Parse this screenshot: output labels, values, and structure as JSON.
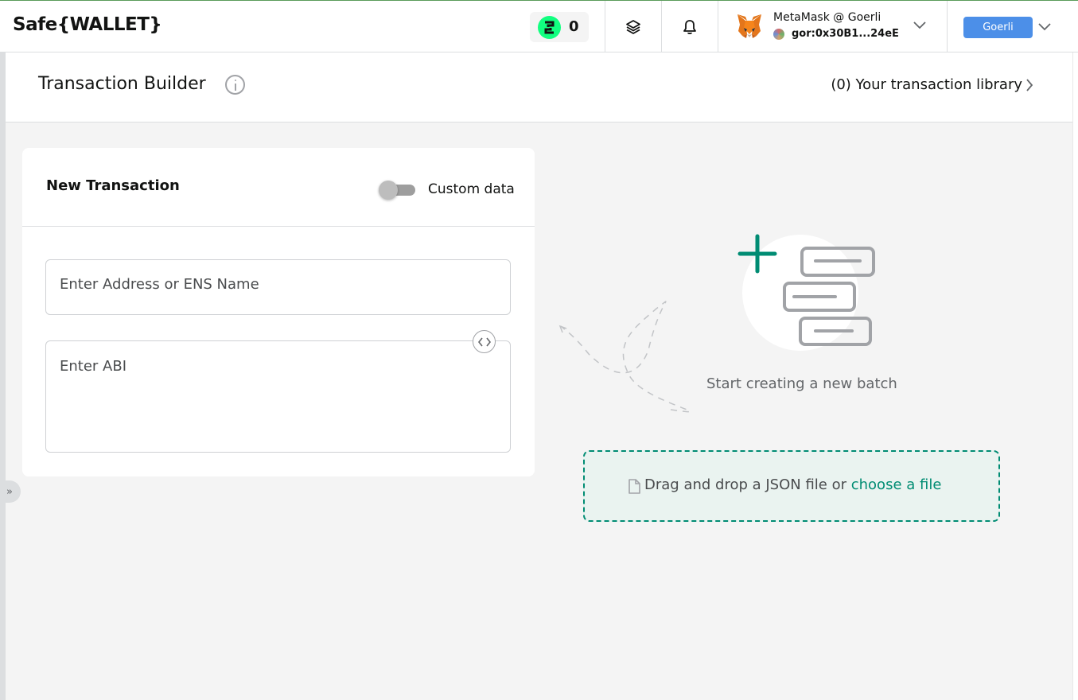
{
  "header": {
    "logo": "Safe{WALLET}",
    "safe_token_count": "0",
    "wallet": {
      "name": "MetaMask @ Goerli",
      "address": "gor:0x30B1...24eE"
    },
    "network": "Goerli"
  },
  "titlebar": {
    "title": "Transaction Builder",
    "library_link": "(0) Your transaction library"
  },
  "new_transaction": {
    "title": "New Transaction",
    "custom_data_label": "Custom data",
    "custom_data_enabled": false,
    "address_placeholder": "Enter Address or ENS Name",
    "abi_placeholder": "Enter ABI"
  },
  "empty_state": {
    "text": "Start creating a new batch",
    "dropzone_text": "Drag and drop a JSON file or ",
    "dropzone_link": "choose a file"
  },
  "colors": {
    "accent": "#008c73",
    "network_badge": "#4c8fe8",
    "safe_token": "#12ff80"
  },
  "icons": {
    "layers": "layers-icon",
    "bell": "bell-icon",
    "info": "info-icon",
    "code": "code-icon",
    "file": "file-icon",
    "sidebar_toggle": "double-chevron-right-icon"
  }
}
